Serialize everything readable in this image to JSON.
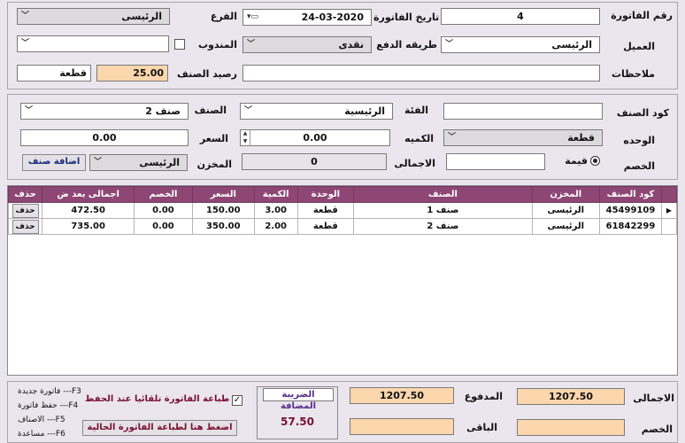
{
  "header": {
    "invoice_no_label": "رقم الفاتورة",
    "invoice_no": "4",
    "invoice_date_label": "تاريخ الفاتورة",
    "invoice_date": "24-03-2020",
    "branch_label": "الفرع",
    "branch": "الرئيسى",
    "client_label": "العميل",
    "client": "الرئيسى",
    "payment_label": "طريقه الدفع",
    "payment": "نقدى",
    "rep_label": "المندوب",
    "rep": "",
    "notes_label": "ملاحظات",
    "notes": "",
    "item_balance_label": "رصيد الصنف",
    "item_balance": "25.00",
    "item_balance_unit": "قطعة"
  },
  "item_entry": {
    "code_label": "كود الصنف",
    "code": "",
    "category_label": "الفئة",
    "category": "الرئيسية",
    "item_label": "الصنف",
    "item": "صنف 2",
    "unit_label": "الوحده",
    "unit": "قطعة",
    "qty_label": "الكميه",
    "qty": "0.00",
    "price_label": "السعر",
    "price": "0.00",
    "discount_label": "الخصم",
    "discount_type": "قيمة",
    "discount": "",
    "total_label": "الاجمالى",
    "total": "0",
    "store_label": "المخزن",
    "store": "الرئيسى",
    "add_item_label": "اضافة صنف"
  },
  "grid": {
    "columns": [
      "كود الصنف",
      "المخزن",
      "الصنف",
      "الوحدة",
      "الكمية",
      "السعر",
      "الخصم",
      "اجمالى بعد ض",
      "حذف"
    ],
    "rows": [
      {
        "code": "45499109",
        "store": "الرئيسى",
        "item": "صنف 1",
        "unit": "قطعة",
        "qty": "3.00",
        "price": "150.00",
        "discount": "0.00",
        "total": "472.50",
        "delete": "حذف"
      },
      {
        "code": "61842299",
        "store": "الرئيسى",
        "item": "صنف 2",
        "unit": "قطعة",
        "qty": "2.00",
        "price": "350.00",
        "discount": "0.00",
        "total": "735.00",
        "delete": "حذف"
      }
    ]
  },
  "footer": {
    "total_label": "الاجمالى",
    "total": "1207.50",
    "paid_label": "المدفوع",
    "paid": "1207.50",
    "discount_label": "الخصم",
    "discount": "",
    "remaining_label": "الباقى",
    "remaining": "",
    "vat_label": "الضريبة المضافة",
    "vat": "57.50",
    "auto_print_label": "طباعة الفاتورة تلقائيا عند الحفظ",
    "auto_print_checked": "✓",
    "print_button_label": "اضغط هنا لطباعة الفاتورة الحالية",
    "shortcuts": [
      "فاتورة جديدة ---F3",
      "حفظ فاتورة ---F4",
      "الاصناف ---F5",
      "مساعدة ---F6"
    ]
  },
  "colors": {
    "header_bg": "#8e4774",
    "peach": "#fcd6ad",
    "window_bg": "#ebe6ee",
    "vat_text": "#7a1030"
  }
}
